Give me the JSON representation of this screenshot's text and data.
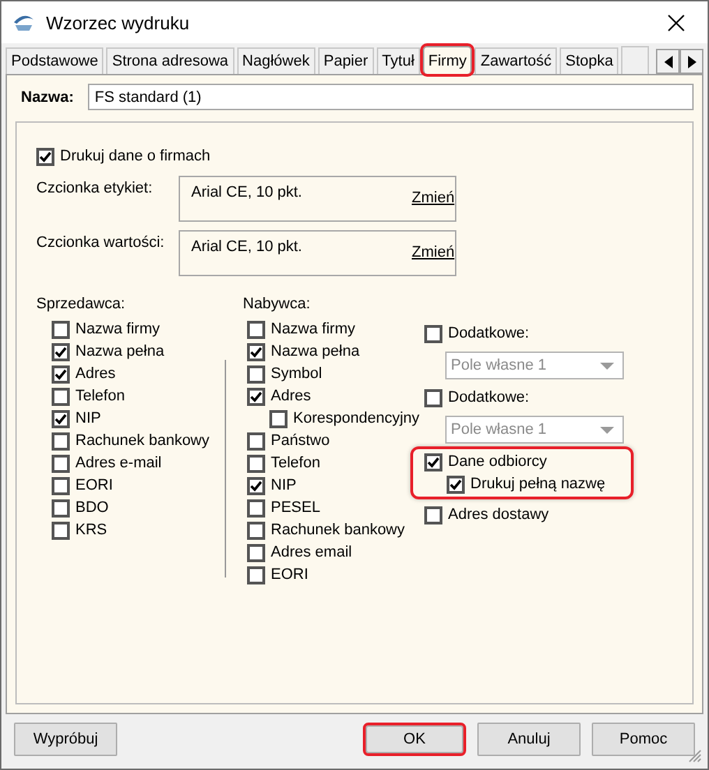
{
  "window": {
    "title": "Wzorzec wydruku"
  },
  "tabs": [
    {
      "label": "Podstawowe",
      "selected": false,
      "highlighted": false
    },
    {
      "label": "Strona adresowa",
      "selected": false,
      "highlighted": false
    },
    {
      "label": "Nagłówek",
      "selected": false,
      "highlighted": false
    },
    {
      "label": "Papier",
      "selected": false,
      "highlighted": false
    },
    {
      "label": "Tytuł",
      "selected": false,
      "highlighted": false
    },
    {
      "label": "Firmy",
      "selected": true,
      "highlighted": true
    },
    {
      "label": "Zawartość",
      "selected": false,
      "highlighted": false
    },
    {
      "label": "Stopka",
      "selected": false,
      "highlighted": false
    }
  ],
  "name_field": {
    "label": "Nazwa:",
    "value": "FS standard (1)"
  },
  "print_companies": {
    "label": "Drukuj dane o firmach",
    "checked": true
  },
  "fonts": [
    {
      "label": "Czcionka etykiet:",
      "value": "Arial CE, 10 pkt.",
      "link": "Zmień"
    },
    {
      "label": "Czcionka wartości:",
      "value": "Arial CE, 10 pkt.",
      "link": "Zmień"
    }
  ],
  "seller": {
    "title": "Sprzedawca:",
    "items": [
      {
        "label": "Nazwa firmy",
        "checked": false
      },
      {
        "label": "Nazwa pełna",
        "checked": true
      },
      {
        "label": "Adres",
        "checked": true
      },
      {
        "label": "Telefon",
        "checked": false
      },
      {
        "label": "NIP",
        "checked": true
      },
      {
        "label": "Rachunek bankowy",
        "checked": false
      },
      {
        "label": "Adres e-mail",
        "checked": false
      },
      {
        "label": "EORI",
        "checked": false
      },
      {
        "label": "BDO",
        "checked": false
      },
      {
        "label": "KRS",
        "checked": false
      }
    ]
  },
  "buyer": {
    "title": "Nabywca:",
    "items": [
      {
        "label": "Nazwa firmy",
        "checked": false
      },
      {
        "label": "Nazwa pełna",
        "checked": true
      },
      {
        "label": "Symbol",
        "checked": false
      },
      {
        "label": "Adres",
        "checked": true,
        "children": [
          {
            "label": "Korespondencyjny",
            "checked": false
          }
        ]
      },
      {
        "label": "Państwo",
        "checked": false
      },
      {
        "label": "Telefon",
        "checked": false
      },
      {
        "label": "NIP",
        "checked": true
      },
      {
        "label": "PESEL",
        "checked": false
      },
      {
        "label": "Rachunek bankowy",
        "checked": false
      },
      {
        "label": "Adres email",
        "checked": false
      },
      {
        "label": "EORI",
        "checked": false
      }
    ]
  },
  "extra": [
    {
      "kind": "checkbox",
      "label": "Dodatkowe:",
      "checked": false,
      "highlighted": false
    },
    {
      "kind": "select",
      "value": "Pole własne 1",
      "disabled": true
    },
    {
      "kind": "checkbox",
      "label": "Dodatkowe:",
      "checked": false,
      "highlighted": false
    },
    {
      "kind": "select",
      "value": "Pole własne 1",
      "disabled": true
    },
    {
      "kind": "checkbox",
      "label": "Dane odbiorcy",
      "checked": true,
      "highlighted": true,
      "children": [
        {
          "label": "Drukuj pełną nazwę",
          "checked": true
        }
      ]
    },
    {
      "kind": "checkbox",
      "label": "Adres dostawy",
      "checked": false,
      "highlighted": false
    }
  ],
  "buttons": [
    {
      "label": "Wypróbuj",
      "highlighted": false
    },
    {
      "label": "OK",
      "highlighted": true
    },
    {
      "label": "Anuluj",
      "highlighted": false
    },
    {
      "label": "Pomoc",
      "highlighted": false
    }
  ]
}
